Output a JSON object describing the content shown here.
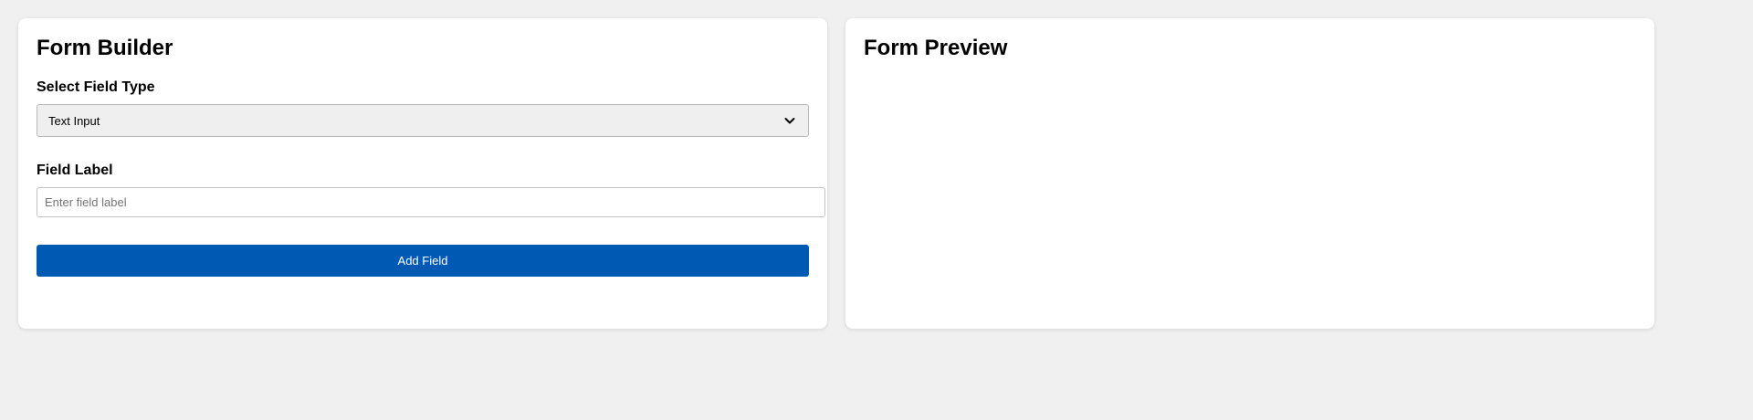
{
  "builder": {
    "title": "Form Builder",
    "field_type_label": "Select Field Type",
    "field_type_selected": "Text Input",
    "field_label_label": "Field Label",
    "field_label_value": "",
    "field_label_placeholder": "Enter field label",
    "add_button_label": "Add Field"
  },
  "preview": {
    "title": "Form Preview"
  },
  "icons": {
    "select_arrow": "chevron-down-icon"
  },
  "colors": {
    "background": "#f0f0f0",
    "panel": "#ffffff",
    "accent": "#0059b3",
    "select_background": "#efefef"
  }
}
